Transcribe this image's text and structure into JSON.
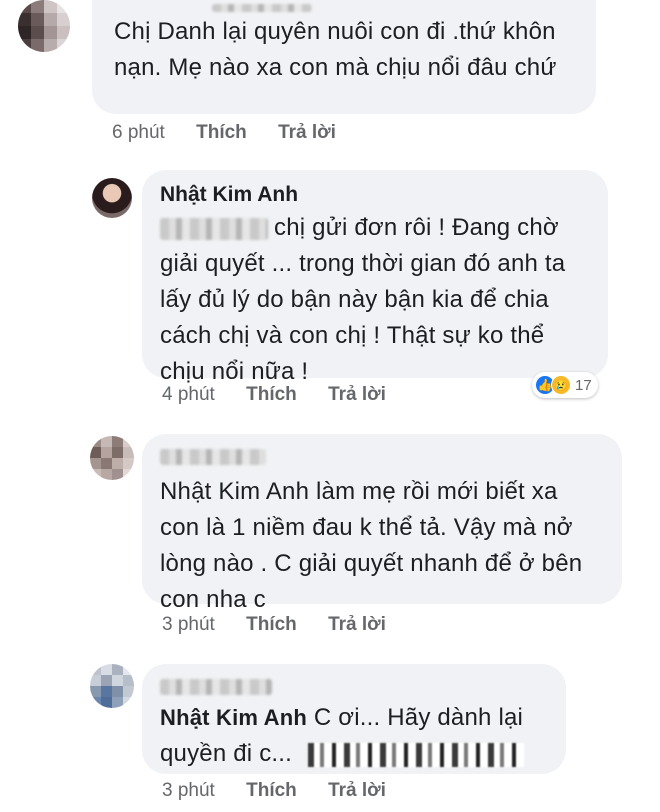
{
  "comments": [
    {
      "author": "",
      "text_lines": [
        "Chị Danh lại quyên nuôi con đi .thứ khôn",
        "nạn. Mẹ nào xa con mà chịu nổi đâu chứ"
      ],
      "time": "6 phút",
      "like_label": "Thích",
      "reply_label": "Trả lời"
    },
    {
      "author": "Nhật Kim Anh",
      "text_lines": [
        "chị gửi đơn rôi ! Đang chờ",
        "giải quyết ... trong thời gian đó anh ta",
        "lấy đủ lý do bận này bận kia để chia",
        "cách chị và con chị ! Thật sự ko thể",
        "chịu nổi nữa !"
      ],
      "time": "4 phút",
      "like_label": "Thích",
      "reply_label": "Trả lời",
      "reaction_count": "17",
      "reaction_icons": [
        "like-icon",
        "sad-icon"
      ]
    },
    {
      "author": "",
      "text_lines": [
        "Nhật Kim Anh làm mẹ rồi mới biết xa",
        "con là 1 niềm đau k thể tả. Vậy mà nở",
        "lòng nào . C giải quyết nhanh để ở bên",
        "con nha c"
      ],
      "time": "3 phút",
      "like_label": "Thích",
      "reply_label": "Trả lời"
    },
    {
      "author_inline": "Nhật Kim Anh",
      "text_first": " C ơi... Hãy dành lại",
      "text_second": "quyền đi c...",
      "time": "3 phút",
      "like_label": "Thích",
      "reply_label": "Trả lời"
    }
  ],
  "colors": {
    "bubble": "#f0f2f5",
    "meta": "#65676b",
    "text": "#1c1e21",
    "like_blue": "#1877f2",
    "sad_yellow": "#f7b928"
  }
}
